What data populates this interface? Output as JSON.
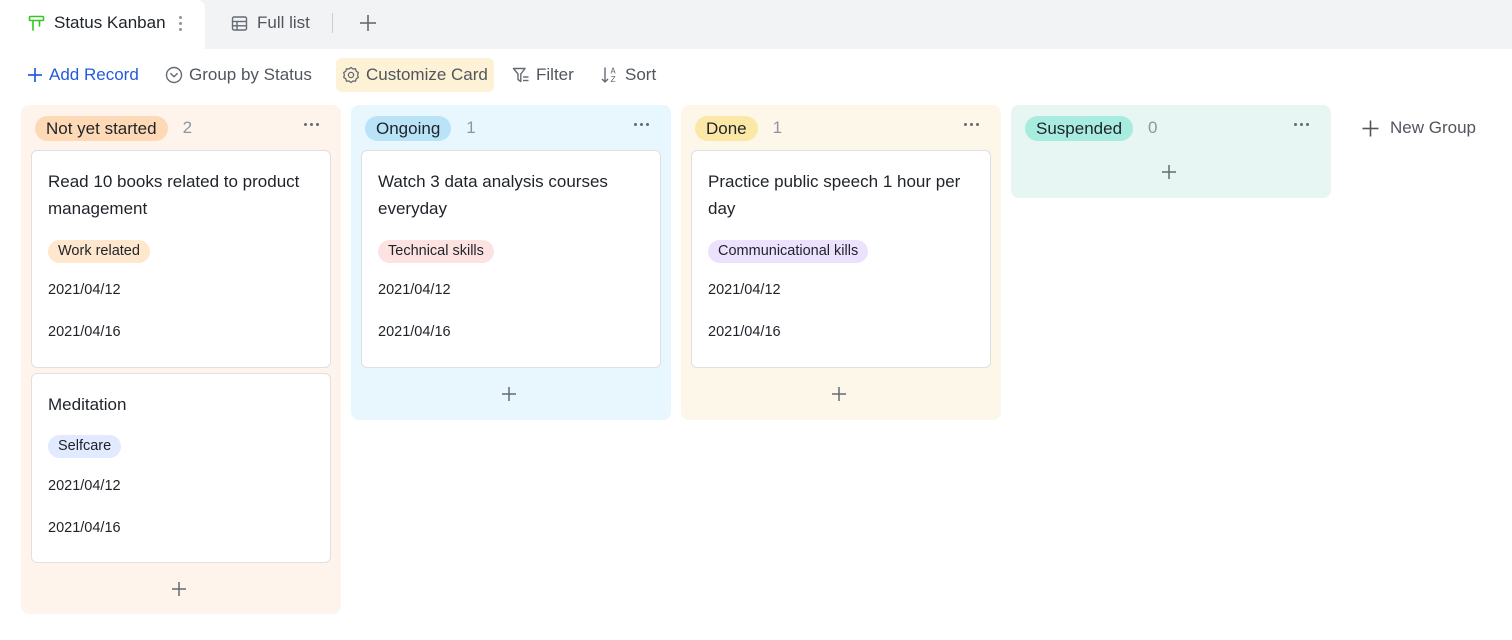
{
  "tabs": [
    {
      "label": "Status Kanban",
      "active": true,
      "icon": "kanban-icon"
    },
    {
      "label": "Full list",
      "active": false,
      "icon": "grid-table-icon"
    }
  ],
  "toolbar": {
    "add_record": "Add Record",
    "group_by": "Group by Status",
    "customize_card": "Customize Card",
    "filter": "Filter",
    "sort": "Sort"
  },
  "columns": [
    {
      "status": "Not yet started",
      "count": "2",
      "colors": {
        "bg": "#fef4ec",
        "tag": "#fdd9b5"
      },
      "cards": [
        {
          "title": "Read 10 books related to product management",
          "tag": "Work related",
          "tag_color": "#fee7cd",
          "start_date": "2021/04/12",
          "end_date": "2021/04/16"
        },
        {
          "title": "Meditation",
          "tag": "Selfcare",
          "tag_color": "#e1eaff",
          "start_date": "2021/04/12",
          "end_date": "2021/04/16"
        }
      ]
    },
    {
      "status": "Ongoing",
      "count": "1",
      "colors": {
        "bg": "#e8f7fd",
        "tag": "#b9e4f8"
      },
      "cards": [
        {
          "title": "Watch 3 data analysis courses everyday",
          "tag": "Technical skills",
          "tag_color": "#fde2e2",
          "start_date": "2021/04/12",
          "end_date": "2021/04/16"
        }
      ]
    },
    {
      "status": "Done",
      "count": "1",
      "colors": {
        "bg": "#fdf7ea",
        "tag": "#fbe8a6"
      },
      "cards": [
        {
          "title": "Practice public speech 1 hour per day",
          "tag": "Communicational kills",
          "tag_color": "#ece2fe",
          "start_date": "2021/04/12",
          "end_date": "2021/04/16"
        }
      ]
    },
    {
      "status": "Suspended",
      "count": "0",
      "colors": {
        "bg": "#e7f6f2",
        "tag": "#a8ece0"
      },
      "cards": []
    }
  ],
  "new_group": "New Group",
  "accent_color": "#245bdb"
}
